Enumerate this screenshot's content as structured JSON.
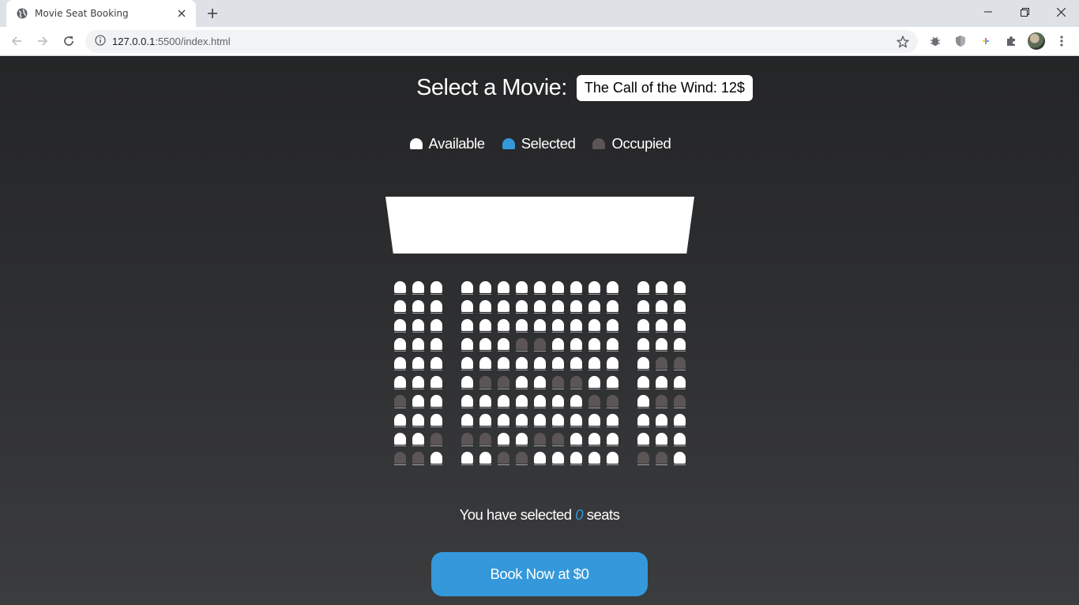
{
  "browser": {
    "tab_title": "Movie Seat Booking",
    "url_host": "127.0.0.1",
    "url_rest": ":5500/index.html"
  },
  "page": {
    "movie_label": "Select a Movie:",
    "selected_movie": "The Call of the Wind: 12$",
    "legend": {
      "available": "Available",
      "selected": "Selected",
      "occupied": "Occupied"
    },
    "summary_prefix": "You have selected",
    "selected_count": "0",
    "summary_suffix": "seats",
    "book_button": "Book Now at $0"
  },
  "seat_colors": {
    "available": "#ffffff",
    "occupied": "#5c5556",
    "selected": "#3498db"
  },
  "seat_map": [
    "AAA AAAAAAAAA AAA",
    "AAA AAAAAAAAA AAA",
    "AAA AAAAAAAAA AAA",
    "AAA AAAOOAAAA AAA",
    "AAA AAAAAAAAA AOO",
    "AAA AOOAAOOAA AAA",
    "OAA AAAAAAAOO AOO",
    "AAA AAAAAAAAA AAA",
    "AAO OOAAOOAAA AAA",
    "OOA AAOOAAAAA OOA"
  ]
}
